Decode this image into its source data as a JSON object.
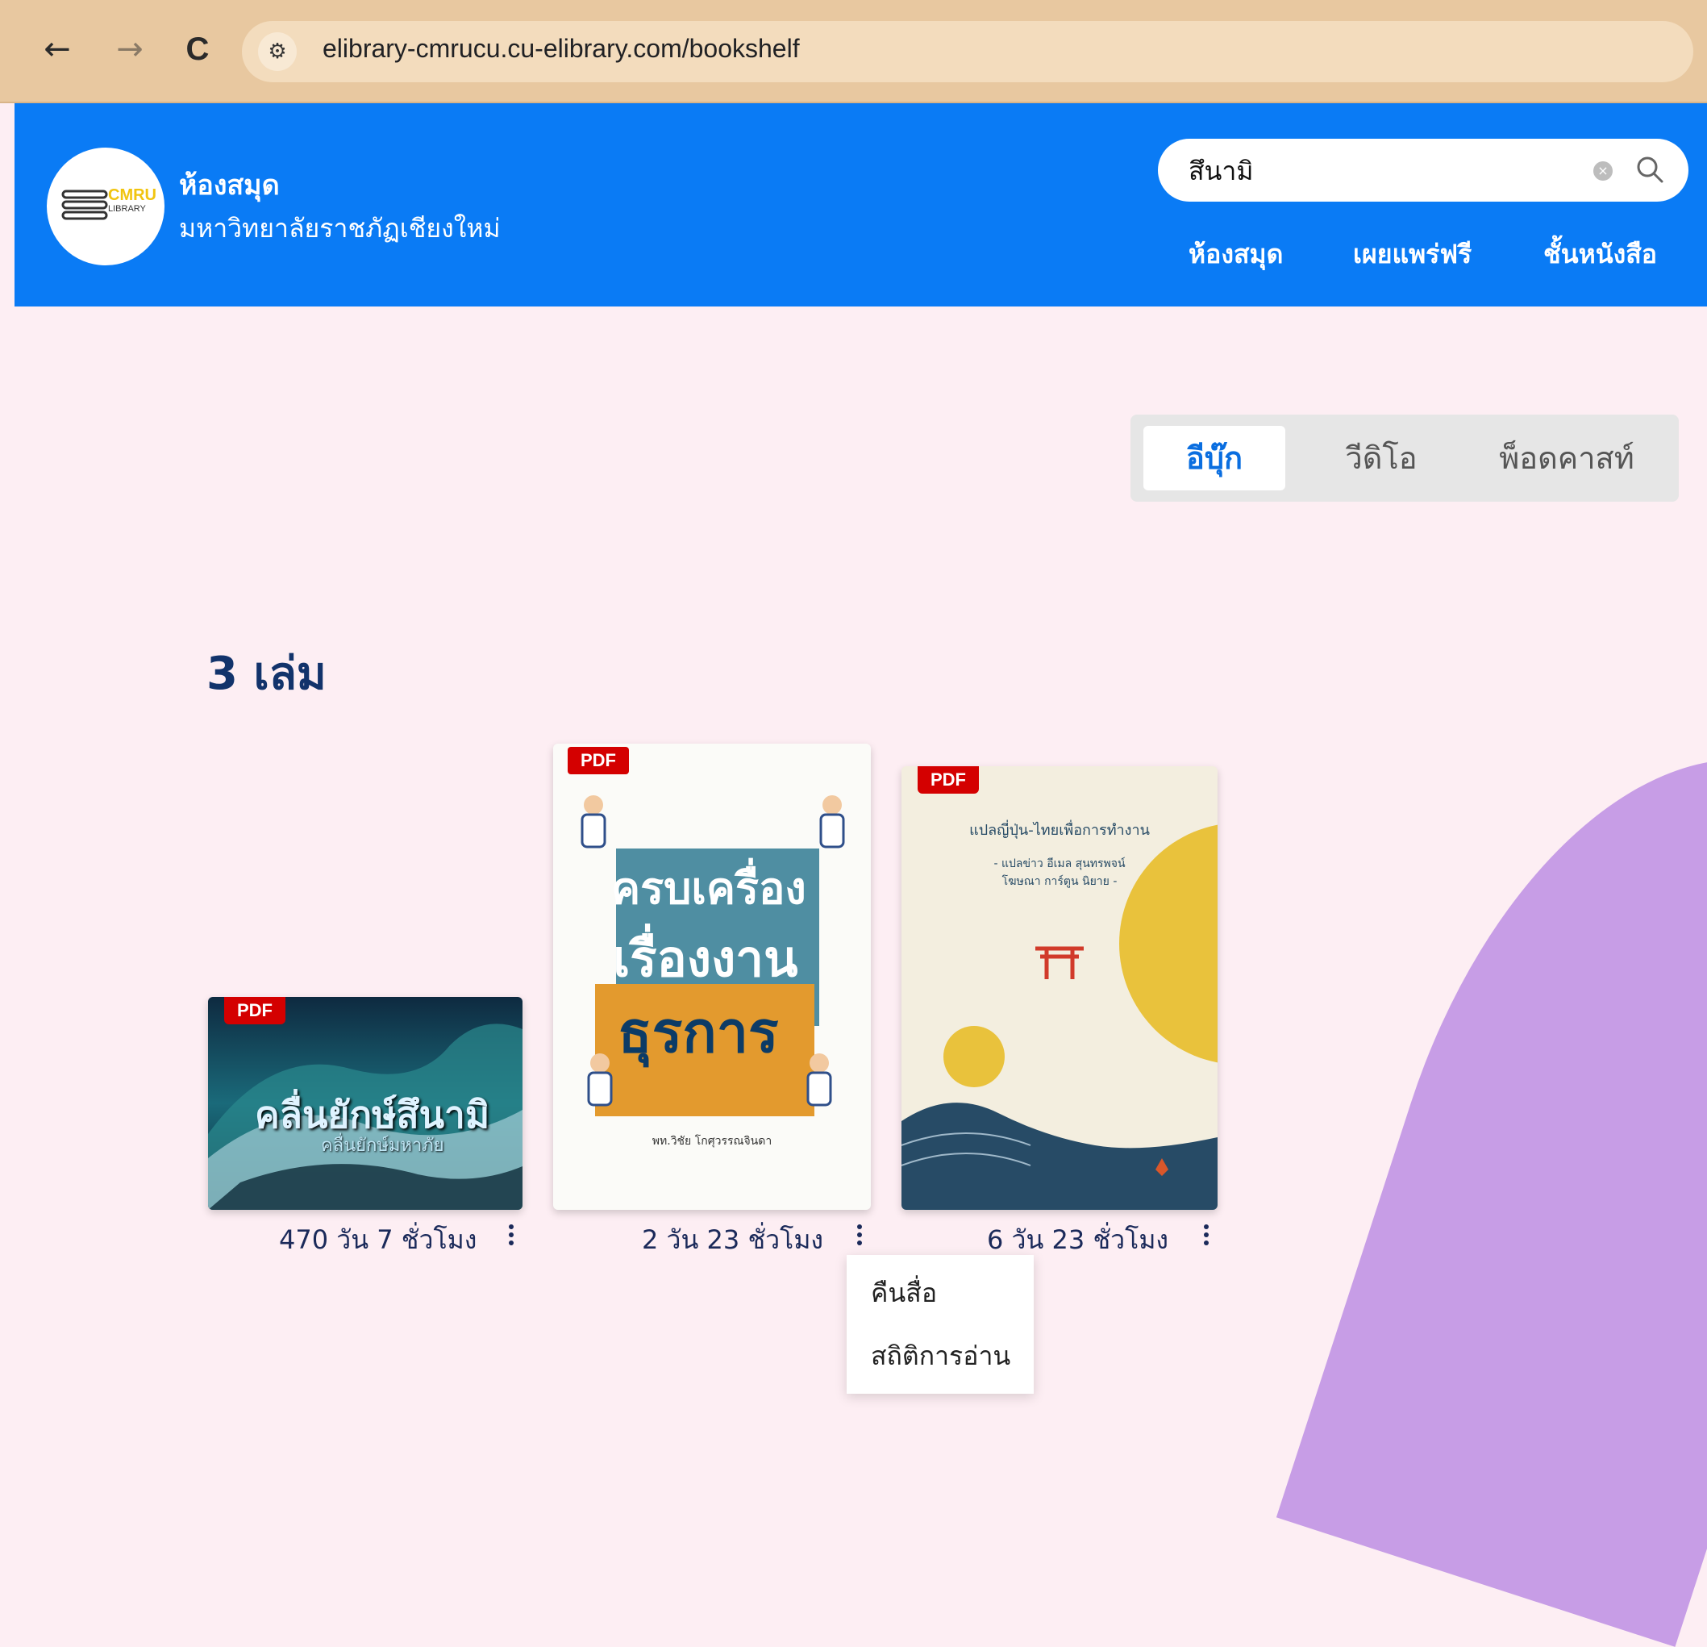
{
  "browser": {
    "url": "elibrary-cmrucu.cu-elibrary.com/bookshelf",
    "back": "←",
    "forward": "→",
    "reload": "C"
  },
  "header": {
    "logo_text": "CMRU",
    "logo_sub": "LIBRARY",
    "title": "ห้องสมุด",
    "subtitle": "มหาวิทยาลัยราชภัฏเชียงใหม่",
    "search_value": "สึนามิ",
    "nav": [
      "ห้องสมุด",
      "เผยแพร่ฟรี",
      "ชั้นหนังสือ"
    ]
  },
  "tabs": [
    "อีบุ๊ก",
    "วีดิโอ",
    "พ็อดคาสท์"
  ],
  "count_label": "3 เล่ม",
  "books": [
    {
      "badge": "PDF",
      "cover_title": "คลื่นยักษ์สึนามิ",
      "cover_sub": "คลื่นยักษ์มหาภัย",
      "caption": "470 วัน 7 ชั่วโมง"
    },
    {
      "badge": "PDF",
      "cover_title_1": "ครบเครื่อง",
      "cover_title_2": "เรื่องงาน",
      "cover_title_3": "ธุรการ",
      "cover_author": "พท.วิชัย โกศุวรรณจินดา",
      "caption": "2 วัน 23 ชั่วโมง"
    },
    {
      "badge": "PDF",
      "cover_title": "แปลญี่ปุ่น-ไทยเพื่อการทำงาน",
      "cover_credit_1": "- แปลข่าว อีเมล สุนทรพจน์",
      "cover_credit_2": "โฆษณา การ์ตูน นิยาย -",
      "caption": "6 วัน 23 ชั่วโมง"
    }
  ],
  "context_menu": [
    "คืนสื่อ",
    "สถิติการอ่าน"
  ],
  "colors": {
    "header_blue": "#0a7bf5",
    "title_navy": "#12336b",
    "pdf_red": "#d40000",
    "active_tab": "#0a6ee0"
  }
}
